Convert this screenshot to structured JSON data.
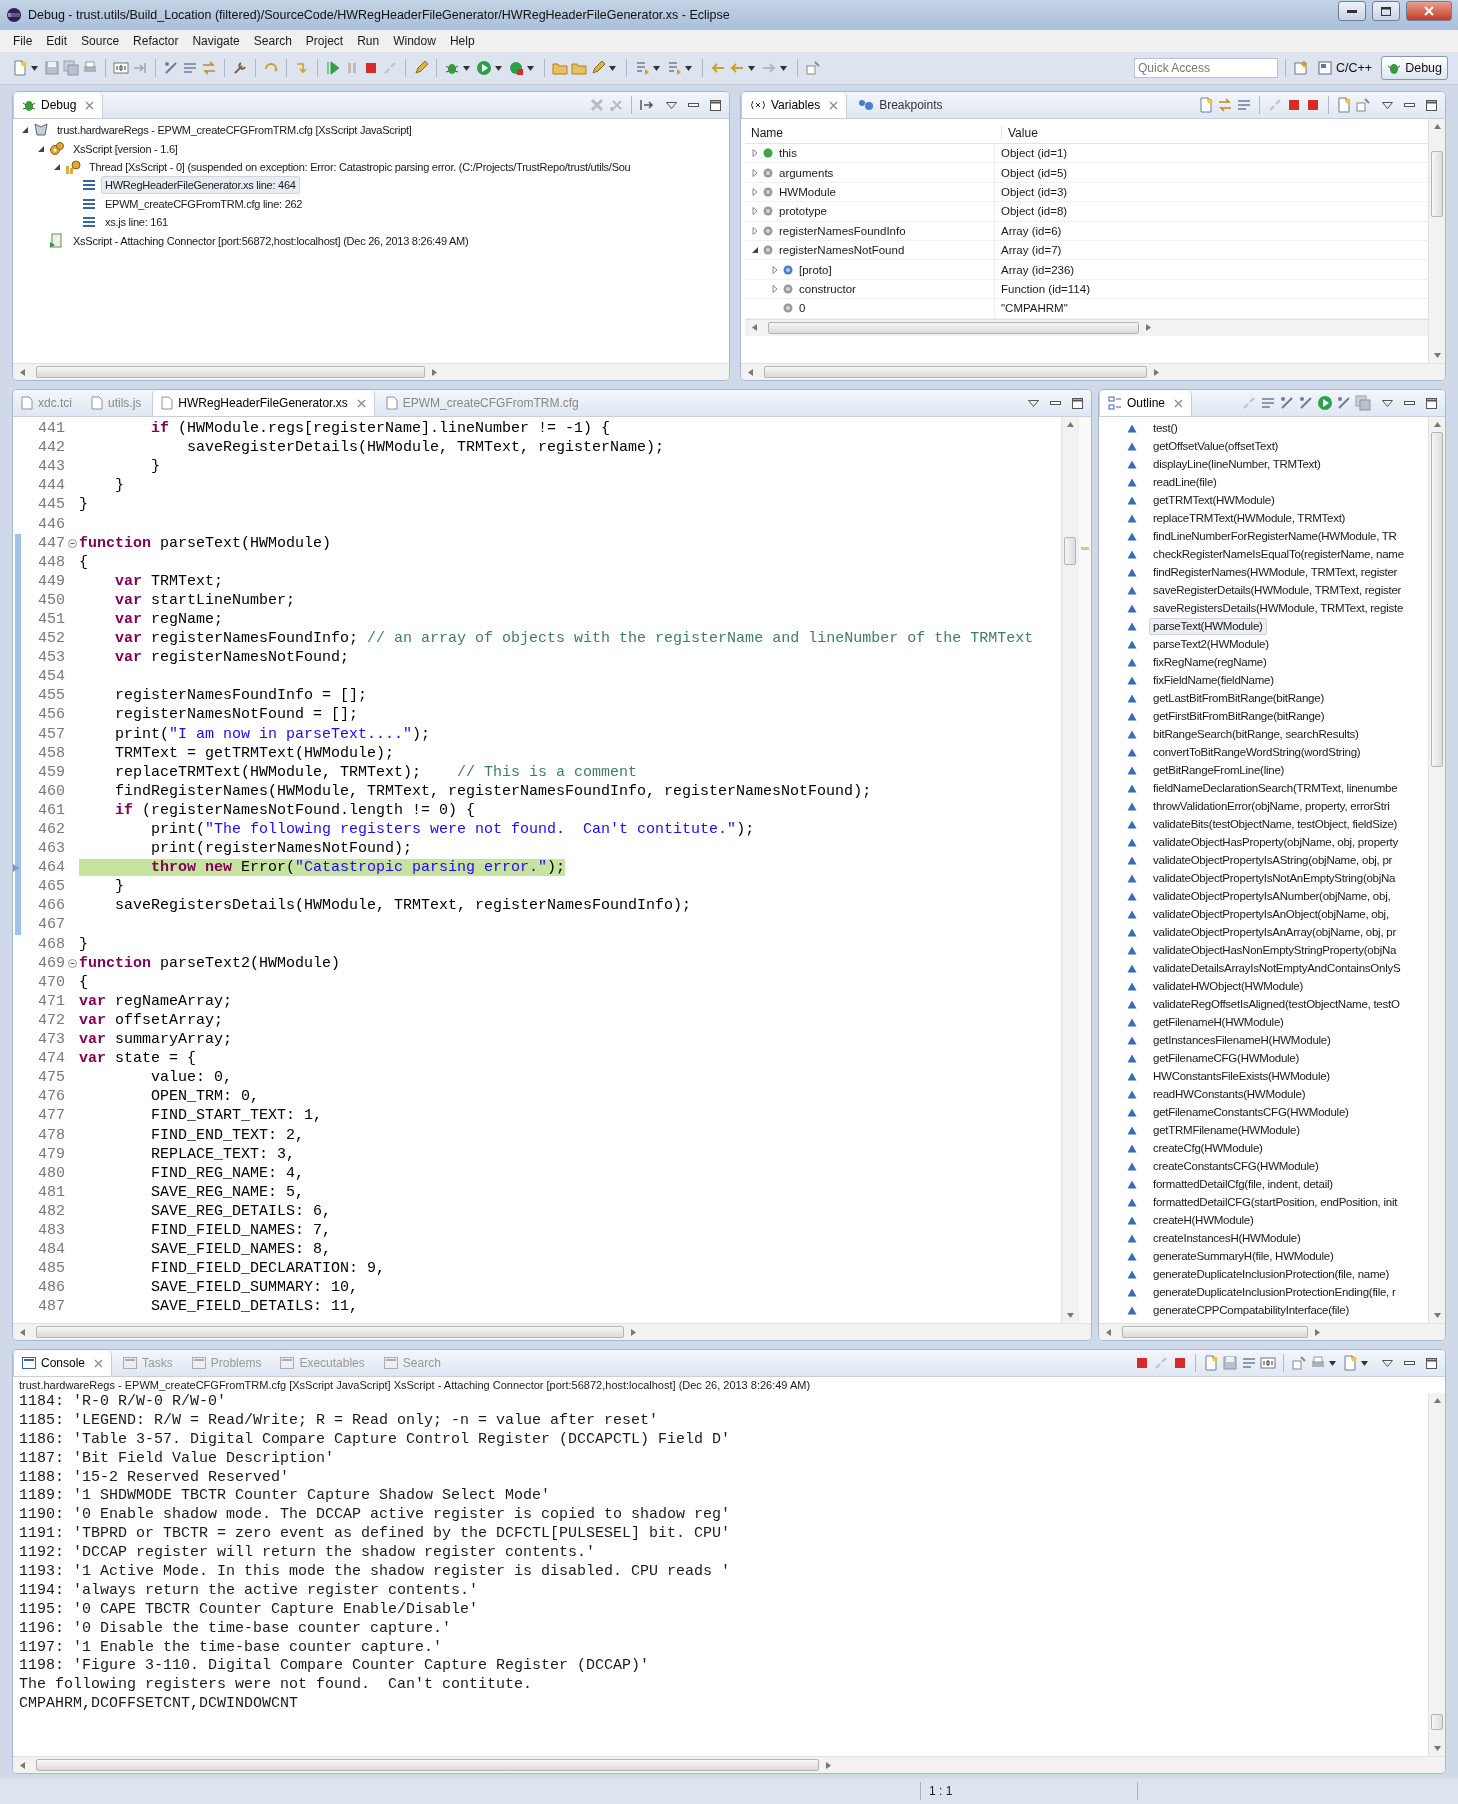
{
  "window": {
    "title": "Debug - trust.utils/Build_Location (filtered)/SourceCode/HWRegHeaderFileGenerator/HWRegHeaderFileGenerator.xs - Eclipse"
  },
  "menu": [
    "File",
    "Edit",
    "Source",
    "Refactor",
    "Navigate",
    "Search",
    "Project",
    "Run",
    "Window",
    "Help"
  ],
  "toolbar": {
    "quick_access": {
      "placeholder": "Quick Access"
    },
    "perspectives": [
      {
        "label": "C/C++",
        "selected": false
      },
      {
        "label": "Debug",
        "selected": true
      }
    ]
  },
  "debug_view": {
    "tab": "Debug",
    "tree": [
      {
        "label": "trust.hardwareRegs - EPWM_createCFGFromTRM.cfg [XsScript JavaScript]",
        "kind": "launch",
        "expanded": true,
        "selected": false,
        "children": [
          {
            "label": "XsScript [version - 1.6]",
            "kind": "target",
            "expanded": true,
            "selected": false,
            "children": [
              {
                "label": "Thread [XsScript - 0] (suspended on exception: Error: Catastropic parsing error. (C:/Projects/TrustRepo/trust/utils/Sou",
                "kind": "thread",
                "expanded": true,
                "selected": false,
                "children": [
                  {
                    "label": "HWRegHeaderFileGenerator.xs line: 464",
                    "kind": "frame",
                    "selected": true
                  },
                  {
                    "label": "EPWM_createCFGFromTRM.cfg line: 262",
                    "kind": "frame",
                    "selected": false
                  },
                  {
                    "label": "xs.js line: 161",
                    "kind": "frame",
                    "selected": false
                  }
                ]
              }
            ]
          },
          {
            "label": "XsScript - Attaching Connector [port:56872,host:localhost] (Dec 26, 2013 8:26:49 AM)",
            "kind": "process",
            "selected": false
          }
        ]
      }
    ]
  },
  "variables_view": {
    "tabs": [
      {
        "label": "Variables",
        "selected": true
      },
      {
        "label": "Breakpoints",
        "selected": false
      }
    ],
    "columns": [
      "Name",
      "Value"
    ],
    "rows": [
      {
        "name": "this",
        "value": "Object (id=1)",
        "kind": "this",
        "expanded": false
      },
      {
        "name": "arguments",
        "value": "Object (id=5)",
        "kind": "local",
        "expanded": false
      },
      {
        "name": "HWModule",
        "value": "Object (id=3)",
        "kind": "local",
        "expanded": false
      },
      {
        "name": "prototype",
        "value": "Object (id=8)",
        "kind": "local",
        "expanded": false
      },
      {
        "name": "registerNamesFoundInfo",
        "value": "Array (id=6)",
        "kind": "local",
        "expanded": false
      },
      {
        "name": "registerNamesNotFound",
        "value": "Array (id=7)",
        "kind": "local",
        "expanded": true,
        "children": [
          {
            "name": "[proto]",
            "value": "Array (id=236)",
            "kind": "proto",
            "expanded": false
          },
          {
            "name": "constructor",
            "value": "Function (id=114)",
            "kind": "local",
            "expanded": false
          },
          {
            "name": "0",
            "value": "\"CMPAHRM\"",
            "kind": "local"
          }
        ]
      }
    ]
  },
  "editor": {
    "tabs": [
      {
        "label": "xdc.tci",
        "selected": false
      },
      {
        "label": "utils.js",
        "selected": false
      },
      {
        "label": "HWRegHeaderFileGenerator.xs",
        "selected": true
      },
      {
        "label": "EPWM_createCFGFromTRM.cfg",
        "selected": false
      }
    ],
    "lines": [
      {
        "number": "441",
        "marked": false,
        "fold": false,
        "current": false,
        "segments": [
          {
            "kind": "keyword",
            "text": "        if"
          },
          {
            "kind": "plain",
            "text": " (HWModule.regs[registerName].lineNumber != -1) {"
          }
        ]
      },
      {
        "number": "442",
        "marked": false,
        "fold": false,
        "current": false,
        "segments": [
          {
            "kind": "plain",
            "text": "            saveRegisterDetails(HWModule, TRMText, registerName);"
          }
        ]
      },
      {
        "number": "443",
        "marked": false,
        "fold": false,
        "current": false,
        "segments": [
          {
            "kind": "plain",
            "text": "        }"
          }
        ]
      },
      {
        "number": "444",
        "marked": false,
        "fold": false,
        "current": false,
        "segments": [
          {
            "kind": "plain",
            "text": "    }"
          }
        ]
      },
      {
        "number": "445",
        "marked": false,
        "fold": false,
        "current": false,
        "segments": [
          {
            "kind": "plain",
            "text": "}"
          }
        ]
      },
      {
        "number": "446",
        "marked": false,
        "fold": false,
        "current": false
      },
      {
        "number": "447",
        "marked": true,
        "fold": true,
        "current": false,
        "segments": [
          {
            "kind": "keyword",
            "text": "function"
          },
          {
            "kind": "plain",
            "text": " parseText(HWModule)"
          }
        ]
      },
      {
        "number": "448",
        "marked": true,
        "fold": false,
        "current": false,
        "segments": [
          {
            "kind": "plain",
            "text": "{"
          }
        ]
      },
      {
        "number": "449",
        "marked": true,
        "fold": false,
        "current": false,
        "segments": [
          {
            "kind": "keyword",
            "text": "    var"
          },
          {
            "kind": "plain",
            "text": " TRMText;"
          }
        ]
      },
      {
        "number": "450",
        "marked": true,
        "fold": false,
        "current": false,
        "segments": [
          {
            "kind": "keyword",
            "text": "    var"
          },
          {
            "kind": "plain",
            "text": " startLineNumber;"
          }
        ]
      },
      {
        "number": "451",
        "marked": true,
        "fold": false,
        "current": false,
        "segments": [
          {
            "kind": "keyword",
            "text": "    var"
          },
          {
            "kind": "plain",
            "text": " regName;"
          }
        ]
      },
      {
        "number": "452",
        "marked": true,
        "fold": false,
        "current": false,
        "segments": [
          {
            "kind": "keyword",
            "text": "    var"
          },
          {
            "kind": "plain",
            "text": " registerNamesFoundInfo; "
          },
          {
            "kind": "comment",
            "text": "// an array of objects with the registerName and lineNumber of the TRMText"
          }
        ]
      },
      {
        "number": "453",
        "marked": true,
        "fold": false,
        "current": false,
        "segments": [
          {
            "kind": "keyword",
            "text": "    var"
          },
          {
            "kind": "plain",
            "text": " registerNamesNotFound;"
          }
        ]
      },
      {
        "number": "454",
        "marked": true,
        "fold": false,
        "current": false
      },
      {
        "number": "455",
        "marked": true,
        "fold": false,
        "current": false,
        "segments": [
          {
            "kind": "plain",
            "text": "    registerNamesFoundInfo = [];"
          }
        ]
      },
      {
        "number": "456",
        "marked": true,
        "fold": false,
        "current": false,
        "segments": [
          {
            "kind": "plain",
            "text": "    registerNamesNotFound = [];"
          }
        ]
      },
      {
        "number": "457",
        "marked": true,
        "fold": false,
        "current": false,
        "segments": [
          {
            "kind": "plain",
            "text": "    print("
          },
          {
            "kind": "string",
            "text": "\"I am now in parseText....\""
          },
          {
            "kind": "plain",
            "text": ");"
          }
        ]
      },
      {
        "number": "458",
        "marked": true,
        "fold": false,
        "current": false,
        "segments": [
          {
            "kind": "plain",
            "text": "    TRMText = getTRMText(HWModule);"
          }
        ]
      },
      {
        "number": "459",
        "marked": true,
        "fold": false,
        "current": false,
        "segments": [
          {
            "kind": "plain",
            "text": "    replaceTRMText(HWModule, TRMText);    "
          },
          {
            "kind": "comment",
            "text": "// This is a comment"
          }
        ]
      },
      {
        "number": "460",
        "marked": true,
        "fold": false,
        "current": false,
        "segments": [
          {
            "kind": "plain",
            "text": "    findRegisterNames(HWModule, TRMText, registerNamesFoundInfo, registerNamesNotFound);"
          }
        ]
      },
      {
        "number": "461",
        "marked": true,
        "fold": false,
        "current": false,
        "segments": [
          {
            "kind": "keyword",
            "text": "    if"
          },
          {
            "kind": "plain",
            "text": " (registerNamesNotFound.length != 0) {"
          }
        ]
      },
      {
        "number": "462",
        "marked": true,
        "fold": false,
        "current": false,
        "segments": [
          {
            "kind": "plain",
            "text": "        print("
          },
          {
            "kind": "string",
            "text": "\"The following registers were not found.  Can't contitute.\""
          },
          {
            "kind": "plain",
            "text": ");"
          }
        ]
      },
      {
        "number": "463",
        "marked": true,
        "fold": false,
        "current": false,
        "segments": [
          {
            "kind": "plain",
            "text": "        print(registerNamesNotFound);"
          }
        ]
      },
      {
        "number": "464",
        "marked": true,
        "fold": false,
        "current": true,
        "segments": [
          {
            "kind": "keyword",
            "text": "        throw new"
          },
          {
            "kind": "plain",
            "text": " Error("
          },
          {
            "kind": "string",
            "text": "\"Catastropic parsing error.\""
          },
          {
            "kind": "plain",
            "text": ");"
          }
        ]
      },
      {
        "number": "465",
        "marked": true,
        "fold": false,
        "current": false,
        "segments": [
          {
            "kind": "plain",
            "text": "    }"
          }
        ]
      },
      {
        "number": "466",
        "marked": true,
        "fold": false,
        "current": false,
        "segments": [
          {
            "kind": "plain",
            "text": "    saveRegistersDetails(HWModule, TRMText, registerNamesFoundInfo);"
          }
        ]
      },
      {
        "number": "467",
        "marked": true,
        "fold": false,
        "current": false
      },
      {
        "number": "468",
        "marked": false,
        "fold": false,
        "current": false,
        "segments": [
          {
            "kind": "plain",
            "text": "}"
          }
        ]
      },
      {
        "number": "469",
        "marked": false,
        "fold": true,
        "current": false,
        "segments": [
          {
            "kind": "keyword",
            "text": "function"
          },
          {
            "kind": "plain",
            "text": " parseText2(HWModule)"
          }
        ]
      },
      {
        "number": "470",
        "marked": false,
        "fold": false,
        "current": false,
        "segments": [
          {
            "kind": "plain",
            "text": "{"
          }
        ]
      },
      {
        "number": "471",
        "marked": false,
        "fold": false,
        "current": false,
        "segments": [
          {
            "kind": "keyword",
            "text": "var"
          },
          {
            "kind": "plain",
            "text": " regNameArray;"
          }
        ]
      },
      {
        "number": "472",
        "marked": false,
        "fold": false,
        "current": false,
        "segments": [
          {
            "kind": "keyword",
            "text": "var"
          },
          {
            "kind": "plain",
            "text": " offsetArray;"
          }
        ]
      },
      {
        "number": "473",
        "marked": false,
        "fold": false,
        "current": false,
        "segments": [
          {
            "kind": "keyword",
            "text": "var"
          },
          {
            "kind": "plain",
            "text": " summaryArray;"
          }
        ]
      },
      {
        "number": "474",
        "marked": false,
        "fold": false,
        "current": false,
        "segments": [
          {
            "kind": "keyword",
            "text": "var"
          },
          {
            "kind": "plain",
            "text": " state = {"
          }
        ]
      },
      {
        "number": "475",
        "marked": false,
        "fold": false,
        "current": false,
        "segments": [
          {
            "kind": "plain",
            "text": "        value: 0,"
          }
        ]
      },
      {
        "number": "476",
        "marked": false,
        "fold": false,
        "current": false,
        "segments": [
          {
            "kind": "plain",
            "text": "        OPEN_TRM: 0,"
          }
        ]
      },
      {
        "number": "477",
        "marked": false,
        "fold": false,
        "current": false,
        "segments": [
          {
            "kind": "plain",
            "text": "        FIND_START_TEXT: 1,"
          }
        ]
      },
      {
        "number": "478",
        "marked": false,
        "fold": false,
        "current": false,
        "segments": [
          {
            "kind": "plain",
            "text": "        FIND_END_TEXT: 2,"
          }
        ]
      },
      {
        "number": "479",
        "marked": false,
        "fold": false,
        "current": false,
        "segments": [
          {
            "kind": "plain",
            "text": "        REPLACE_TEXT: 3,"
          }
        ]
      },
      {
        "number": "480",
        "marked": false,
        "fold": false,
        "current": false,
        "segments": [
          {
            "kind": "plain",
            "text": "        FIND_REG_NAME: 4,"
          }
        ]
      },
      {
        "number": "481",
        "marked": false,
        "fold": false,
        "current": false,
        "segments": [
          {
            "kind": "plain",
            "text": "        SAVE_REG_NAME: 5,"
          }
        ]
      },
      {
        "number": "482",
        "marked": false,
        "fold": false,
        "current": false,
        "segments": [
          {
            "kind": "plain",
            "text": "        SAVE_REG_DETAILS: 6,"
          }
        ]
      },
      {
        "number": "483",
        "marked": false,
        "fold": false,
        "current": false,
        "segments": [
          {
            "kind": "plain",
            "text": "        FIND_FIELD_NAMES: 7,"
          }
        ]
      },
      {
        "number": "484",
        "marked": false,
        "fold": false,
        "current": false,
        "segments": [
          {
            "kind": "plain",
            "text": "        SAVE_FIELD_NAMES: 8,"
          }
        ]
      },
      {
        "number": "485",
        "marked": false,
        "fold": false,
        "current": false,
        "segments": [
          {
            "kind": "plain",
            "text": "        FIND_FIELD_DECLARATION: 9,"
          }
        ]
      },
      {
        "number": "486",
        "marked": false,
        "fold": false,
        "current": false,
        "segments": [
          {
            "kind": "plain",
            "text": "        SAVE_FIELD_SUMMARY: 10,"
          }
        ]
      },
      {
        "number": "487",
        "marked": false,
        "fold": false,
        "current": false,
        "segments": [
          {
            "kind": "plain",
            "text": "        SAVE_FIELD_DETAILS: 11,"
          }
        ]
      }
    ]
  },
  "outline": {
    "tab": "Outline",
    "items": [
      {
        "label": "test()",
        "selected": false
      },
      {
        "label": "getOffsetValue(offsetText)",
        "selected": false
      },
      {
        "label": "displayLine(lineNumber, TRMText)",
        "selected": false
      },
      {
        "label": "readLine(file)",
        "selected": false
      },
      {
        "label": "getTRMText(HWModule)",
        "selected": false
      },
      {
        "label": "replaceTRMText(HWModule, TRMText)",
        "selected": false
      },
      {
        "label": "findLineNumberForRegisterName(HWModule, TR",
        "selected": false
      },
      {
        "label": "checkRegisterNameIsEqualTo(registerName, name",
        "selected": false
      },
      {
        "label": "findRegisterNames(HWModule, TRMText, register",
        "selected": false
      },
      {
        "label": "saveRegisterDetails(HWModule, TRMText, register",
        "selected": false
      },
      {
        "label": "saveRegistersDetails(HWModule, TRMText, registe",
        "selected": false
      },
      {
        "label": "parseText(HWModule)",
        "selected": true
      },
      {
        "label": "parseText2(HWModule)",
        "selected": false
      },
      {
        "label": "fixRegName(regName)",
        "selected": false
      },
      {
        "label": "fixFieldName(fieldName)",
        "selected": false
      },
      {
        "label": "getLastBitFromBitRange(bitRange)",
        "selected": false
      },
      {
        "label": "getFirstBitFromBitRange(bitRange)",
        "selected": false
      },
      {
        "label": "bitRangeSearch(bitRange, searchResults)",
        "selected": false
      },
      {
        "label": "convertToBitRangeWordString(wordString)",
        "selected": false
      },
      {
        "label": "getBitRangeFromLine(line)",
        "selected": false
      },
      {
        "label": "fieldNameDeclarationSearch(TRMText, linenumbe",
        "selected": false
      },
      {
        "label": "throwValidationError(objName, property, errorStri",
        "selected": false
      },
      {
        "label": "validateBits(testObjectName, testObject, fieldSize)",
        "selected": false
      },
      {
        "label": "validateObjectHasProperty(objName, obj, property",
        "selected": false
      },
      {
        "label": "validateObjectPropertyIsAString(objName, obj, pr",
        "selected": false
      },
      {
        "label": "validateObjectPropertyIsNotAnEmptyString(objNa",
        "selected": false
      },
      {
        "label": "validateObjectPropertyIsANumber(objName, obj,",
        "selected": false
      },
      {
        "label": "validateObjectPropertyIsAnObject(objName, obj,",
        "selected": false
      },
      {
        "label": "validateObjectPropertyIsAnArray(objName, obj, pr",
        "selected": false
      },
      {
        "label": "validateObjectHasNonEmptyStringProperty(objNa",
        "selected": false
      },
      {
        "label": "validateDetailsArrayIsNotEmptyAndContainsOnlyS",
        "selected": false
      },
      {
        "label": "validateHWObject(HWModule)",
        "selected": false
      },
      {
        "label": "validateRegOffsetIsAligned(testObjectName, testO",
        "selected": false
      },
      {
        "label": "getFilenameH(HWModule)",
        "selected": false
      },
      {
        "label": "getInstancesFilenameH(HWModule)",
        "selected": false
      },
      {
        "label": "getFilenameCFG(HWModule)",
        "selected": false
      },
      {
        "label": "HWConstantsFileExists(HWModule)",
        "selected": false
      },
      {
        "label": "readHWConstants(HWModule)",
        "selected": false
      },
      {
        "label": "getFilenameConstantsCFG(HWModule)",
        "selected": false
      },
      {
        "label": "getTRMFilename(HWModule)",
        "selected": false
      },
      {
        "label": "createCfg(HWModule)",
        "selected": false
      },
      {
        "label": "createConstantsCFG(HWModule)",
        "selected": false
      },
      {
        "label": "formattedDetailCfg(file, indent, detail)",
        "selected": false
      },
      {
        "label": "formattedDetailCFG(startPosition, endPosition, init",
        "selected": false
      },
      {
        "label": "createH(HWModule)",
        "selected": false
      },
      {
        "label": "createInstancesH(HWModule)",
        "selected": false
      },
      {
        "label": "generateSummaryH(file, HWModule)",
        "selected": false
      },
      {
        "label": "generateDuplicateInclusionProtection(file, name)",
        "selected": false
      },
      {
        "label": "generateDuplicateInclusionProtectionEnding(file, r",
        "selected": false
      },
      {
        "label": "generateCPPCompatabilityInterface(file)",
        "selected": false
      }
    ]
  },
  "console": {
    "tabs": [
      {
        "label": "Console",
        "selected": true
      },
      {
        "label": "Tasks",
        "selected": false
      },
      {
        "label": "Problems",
        "selected": false
      },
      {
        "label": "Executables",
        "selected": false
      },
      {
        "label": "Search",
        "selected": false
      }
    ],
    "header": "trust.hardwareRegs - EPWM_createCFGFromTRM.cfg [XsScript JavaScript] XsScript - Attaching Connector [port:56872,host:localhost] (Dec 26, 2013 8:26:49 AM)",
    "lines": [
      "1184: 'R-0 R/W-0 R/W-0'",
      "1185: 'LEGEND: R/W = Read/Write; R = Read only; -n = value after reset'",
      "1186: 'Table 3-57. Digital Compare Capture Control Register (DCCAPCTL) Field D'",
      "1187: 'Bit Field Value Description'",
      "1188: '15-2 Reserved Reserved'",
      "1189: '1 SHDWMODE TBCTR Counter Capture Shadow Select Mode'",
      "1190: '0 Enable shadow mode. The DCCAP active register is copied to shadow reg'",
      "1191: 'TBPRD or TBCTR = zero event as defined by the DCFCTL[PULSESEL] bit. CPU'",
      "1192: 'DCCAP register will return the shadow register contents.'",
      "1193: '1 Active Mode. In this mode the shadow register is disabled. CPU reads '",
      "1194: 'always return the active register contents.'",
      "1195: '0 CAPE TBCTR Counter Capture Enable/Disable'",
      "1196: '0 Disable the time-base counter capture.'",
      "1197: '1 Enable the time-base counter capture.'",
      "1198: 'Figure 3-110. Digital Compare Counter Capture Register (DCCAP)'",
      "The following registers were not found.  Can't contitute.",
      "CMPAHRM,DCOFFSETCNT,DCWINDOWCNT"
    ]
  },
  "status_bar": {
    "position": "1 : 1"
  }
}
